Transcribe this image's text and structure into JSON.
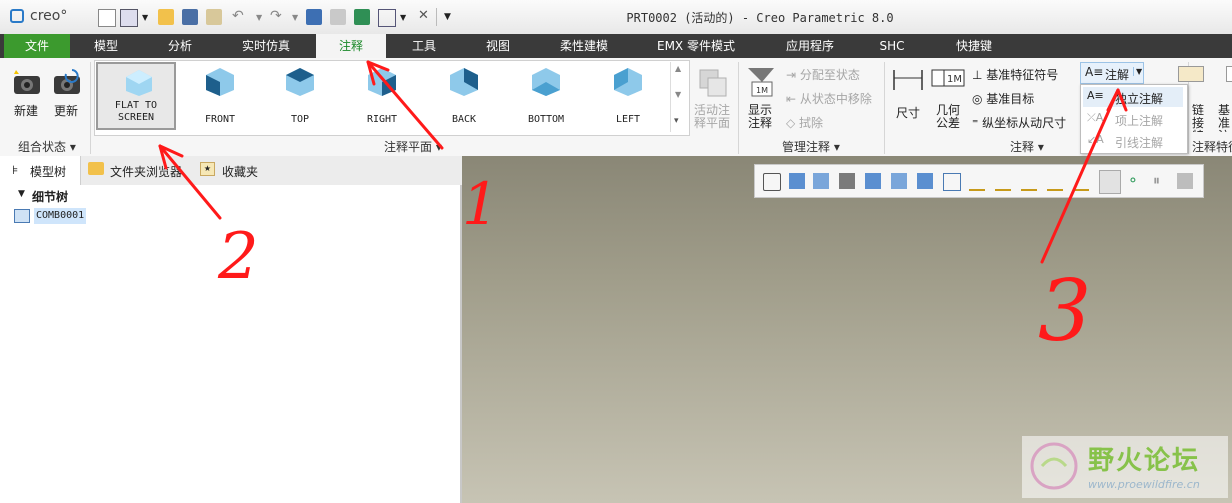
{
  "app": {
    "logo_text": "creo°",
    "window_title": "PRT0002 (活动的) - Creo Parametric 8.0"
  },
  "menu_tabs": [
    "文件",
    "模型",
    "分析",
    "实时仿真",
    "注释",
    "工具",
    "视图",
    "柔性建模",
    "EMX 零件模式",
    "应用程序",
    "SHC",
    "快捷键"
  ],
  "active_tab": "注释",
  "ribbon": {
    "combo_state": {
      "new": "新建",
      "update": "更新",
      "group": "组合状态"
    },
    "annotation_planes": {
      "views": [
        "FLAT TO SCREEN",
        "FRONT",
        "TOP",
        "RIGHT",
        "BACK",
        "BOTTOM",
        "LEFT"
      ],
      "selected": "FLAT TO SCREEN",
      "activate": "活动注释平面",
      "group": "注释平面"
    },
    "manage": {
      "show": "显示注释",
      "assign": "分配至状态",
      "remove_from_state": "从状态中移除",
      "erase": "拭除",
      "group": "管理注释"
    },
    "annotations": {
      "dimension": "尺寸",
      "geom_tolerance": "几何公差",
      "datum_symbol": "基准特征符号",
      "datum_target": "基准目标",
      "ordinate": "纵坐标从动尺寸",
      "note": "注解",
      "group": "注释"
    },
    "note_menu": {
      "items": [
        "独立注解",
        "项上注解",
        "引线注解"
      ]
    },
    "right_partial": {
      "a": "链接特征",
      "b": "基准注",
      "group": "注释特征"
    }
  },
  "panel": {
    "tabs": [
      "模型树",
      "文件夹浏览器",
      "收藏夹"
    ],
    "tree_header": "细节树",
    "tree_item": "COMB0001"
  },
  "annotations_overlay": {
    "n1": "1",
    "n2": "2",
    "n3": "3"
  },
  "watermark": {
    "name": "野火论坛",
    "url": "www.proewildfire.cn"
  },
  "colors": {
    "menubar": "#3a3a3a",
    "file_tab": "#3c9a2e",
    "active_tab_text": "#1b8a2a",
    "arrow": "#ff1a1a"
  }
}
